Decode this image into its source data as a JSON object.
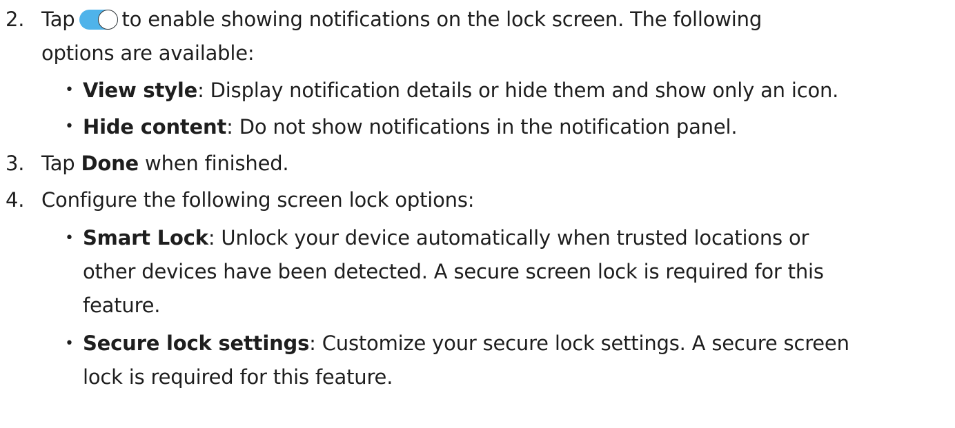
{
  "steps": [
    {
      "number": "2.",
      "lines": [
        {
          "before_toggle": "Tap",
          "after_toggle": "to enable showing notifications on the lock screen. The following"
        },
        {
          "text": "options are available:"
        }
      ],
      "bullets": [
        {
          "term": "View style",
          "desc": ": Display notification details or hide them and show only an icon."
        },
        {
          "term": "Hide content",
          "desc": ": Do not show notifications in the notification panel."
        }
      ]
    },
    {
      "number": "3.",
      "lines": [
        {
          "before": "Tap ",
          "term": "Done",
          "after": " when finished."
        }
      ]
    },
    {
      "number": "4.",
      "lines": [
        {
          "text": "Configure the following screen lock options:"
        }
      ],
      "bullets": [
        {
          "term": "Smart Lock",
          "desc_lines": [
            ": Unlock your device automatically when trusted locations or",
            "other devices have been detected. A secure screen lock is required for this",
            "feature."
          ]
        },
        {
          "term": "Secure lock settings",
          "desc_lines": [
            ": Customize your secure lock settings. A secure screen",
            "lock is required for this feature."
          ]
        }
      ]
    }
  ],
  "toggle": {
    "icon": "toggle-switch-icon",
    "state": "on",
    "track_color": "#4fb3ea",
    "knob_color": "#ffffff"
  },
  "bullet_glyph": "•"
}
